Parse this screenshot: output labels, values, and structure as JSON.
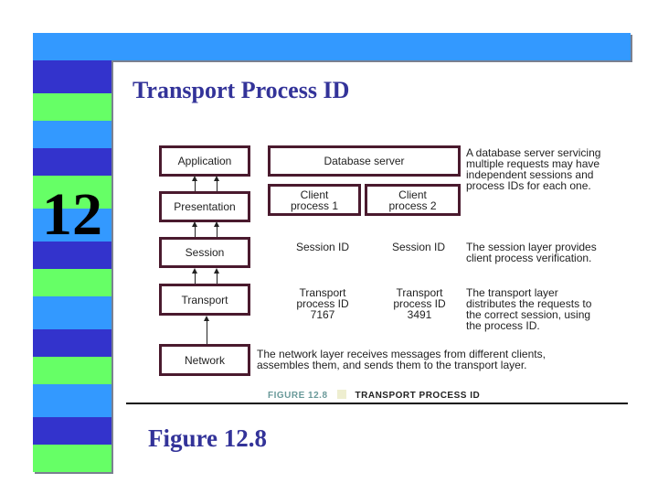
{
  "slide": {
    "number": "12",
    "title": "Transport Process ID",
    "caption": "Figure 12.8",
    "colors": {
      "stripe_dark": "#3333cc",
      "stripe_green": "#66ff66",
      "stripe_light": "#3399ff",
      "title_text": "#333399",
      "box_border": "#4a1a2e"
    }
  },
  "figure": {
    "layers": [
      "Application",
      "Presentation",
      "Session",
      "Transport",
      "Network"
    ],
    "database_server": "Database server",
    "client_process_1": "Client process 1",
    "client_process_2": "Client process 2",
    "session_id_1": "Session ID",
    "session_id_2": "Session ID",
    "transport_id_1": {
      "label": "Transport process ID",
      "value": "7167"
    },
    "transport_id_2": {
      "label": "Transport process ID",
      "value": "3491"
    },
    "notes": {
      "database": "A database server servicing multiple requests may have independent sessions and process IDs for each one.",
      "session": "The session layer provides client process verification.",
      "transport": "The transport layer distributes the requests to the correct session, using the process ID.",
      "network": "The network layer receives messages from different clients, assembles them, and sends them to the transport layer."
    },
    "figure_label": "FIGURE 12.8",
    "figure_name": "TRANSPORT PROCESS ID"
  }
}
